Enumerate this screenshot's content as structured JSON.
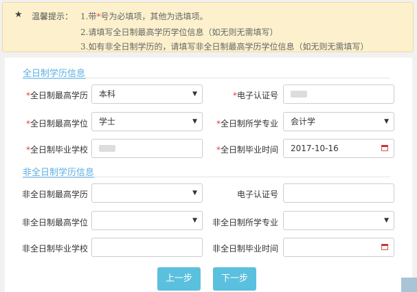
{
  "notice": {
    "title": "温馨提示：",
    "line1_a": "1.带",
    "line1_star": "*",
    "line1_b": "号为必填项，其他为选填项。",
    "line2": "2.请填写全日制最高学历学位信息（如无则无需填写）",
    "line3": "3.如有非全日制学历的，请填写非全日制最高学历学位信息（如无则无需填写）"
  },
  "fulltime": {
    "section_title": "全日制学历信息",
    "required_mark": "*",
    "edu_level_label": "全日制最高学历",
    "edu_level_value": "本科",
    "cert_no_label": "电子认证号",
    "degree_label": "全日制最高学位",
    "degree_value": "学士",
    "major_label": "全日制所学专业",
    "major_value": "会计学",
    "school_label": "全日制毕业学校",
    "grad_time_label": "全日制毕业时间",
    "grad_time_value": "2017-10-16"
  },
  "parttime": {
    "section_title": "非全日制学历信息",
    "edu_level_label": "非全日制最高学历",
    "edu_level_value": "",
    "cert_no_label": "电子认证号",
    "degree_label": "非全日制最高学位",
    "degree_value": "",
    "major_label": "非全日制所学专业",
    "major_value": "",
    "school_label": "非全日制毕业学校",
    "grad_time_label": "非全日制毕业时间",
    "grad_time_value": ""
  },
  "buttons": {
    "prev": "上一步",
    "next": "下一步"
  },
  "icons": {
    "notice": "star-icon",
    "select": "caret-down-icon",
    "date": "calendar-icon"
  },
  "colors": {
    "notice_bg": "#fcf1cc",
    "accent": "#5aaee0",
    "button": "#5bc0de",
    "required": "#e23b3b"
  }
}
